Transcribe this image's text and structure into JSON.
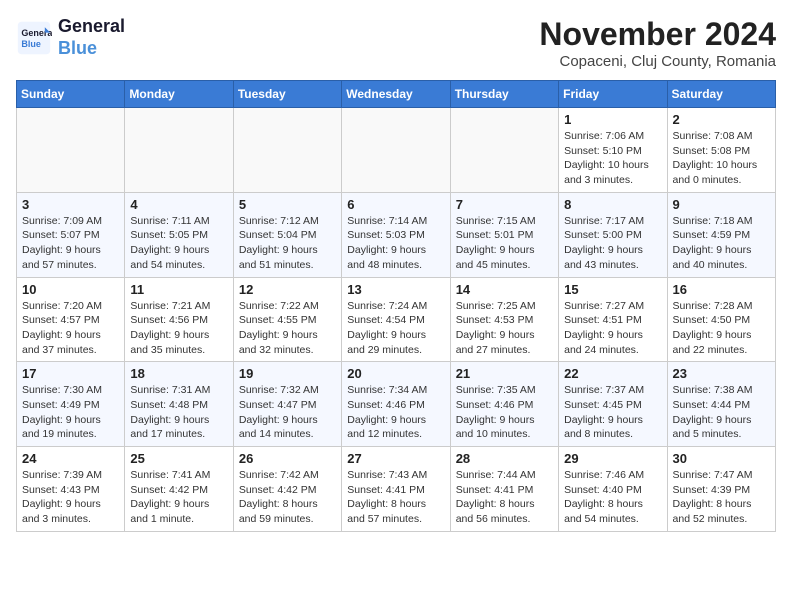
{
  "header": {
    "logo_line1": "General",
    "logo_line2": "Blue",
    "month": "November 2024",
    "location": "Copaceni, Cluj County, Romania"
  },
  "weekdays": [
    "Sunday",
    "Monday",
    "Tuesday",
    "Wednesday",
    "Thursday",
    "Friday",
    "Saturday"
  ],
  "weeks": [
    [
      {
        "day": "",
        "info": ""
      },
      {
        "day": "",
        "info": ""
      },
      {
        "day": "",
        "info": ""
      },
      {
        "day": "",
        "info": ""
      },
      {
        "day": "",
        "info": ""
      },
      {
        "day": "1",
        "info": "Sunrise: 7:06 AM\nSunset: 5:10 PM\nDaylight: 10 hours and 3 minutes."
      },
      {
        "day": "2",
        "info": "Sunrise: 7:08 AM\nSunset: 5:08 PM\nDaylight: 10 hours and 0 minutes."
      }
    ],
    [
      {
        "day": "3",
        "info": "Sunrise: 7:09 AM\nSunset: 5:07 PM\nDaylight: 9 hours and 57 minutes."
      },
      {
        "day": "4",
        "info": "Sunrise: 7:11 AM\nSunset: 5:05 PM\nDaylight: 9 hours and 54 minutes."
      },
      {
        "day": "5",
        "info": "Sunrise: 7:12 AM\nSunset: 5:04 PM\nDaylight: 9 hours and 51 minutes."
      },
      {
        "day": "6",
        "info": "Sunrise: 7:14 AM\nSunset: 5:03 PM\nDaylight: 9 hours and 48 minutes."
      },
      {
        "day": "7",
        "info": "Sunrise: 7:15 AM\nSunset: 5:01 PM\nDaylight: 9 hours and 45 minutes."
      },
      {
        "day": "8",
        "info": "Sunrise: 7:17 AM\nSunset: 5:00 PM\nDaylight: 9 hours and 43 minutes."
      },
      {
        "day": "9",
        "info": "Sunrise: 7:18 AM\nSunset: 4:59 PM\nDaylight: 9 hours and 40 minutes."
      }
    ],
    [
      {
        "day": "10",
        "info": "Sunrise: 7:20 AM\nSunset: 4:57 PM\nDaylight: 9 hours and 37 minutes."
      },
      {
        "day": "11",
        "info": "Sunrise: 7:21 AM\nSunset: 4:56 PM\nDaylight: 9 hours and 35 minutes."
      },
      {
        "day": "12",
        "info": "Sunrise: 7:22 AM\nSunset: 4:55 PM\nDaylight: 9 hours and 32 minutes."
      },
      {
        "day": "13",
        "info": "Sunrise: 7:24 AM\nSunset: 4:54 PM\nDaylight: 9 hours and 29 minutes."
      },
      {
        "day": "14",
        "info": "Sunrise: 7:25 AM\nSunset: 4:53 PM\nDaylight: 9 hours and 27 minutes."
      },
      {
        "day": "15",
        "info": "Sunrise: 7:27 AM\nSunset: 4:51 PM\nDaylight: 9 hours and 24 minutes."
      },
      {
        "day": "16",
        "info": "Sunrise: 7:28 AM\nSunset: 4:50 PM\nDaylight: 9 hours and 22 minutes."
      }
    ],
    [
      {
        "day": "17",
        "info": "Sunrise: 7:30 AM\nSunset: 4:49 PM\nDaylight: 9 hours and 19 minutes."
      },
      {
        "day": "18",
        "info": "Sunrise: 7:31 AM\nSunset: 4:48 PM\nDaylight: 9 hours and 17 minutes."
      },
      {
        "day": "19",
        "info": "Sunrise: 7:32 AM\nSunset: 4:47 PM\nDaylight: 9 hours and 14 minutes."
      },
      {
        "day": "20",
        "info": "Sunrise: 7:34 AM\nSunset: 4:46 PM\nDaylight: 9 hours and 12 minutes."
      },
      {
        "day": "21",
        "info": "Sunrise: 7:35 AM\nSunset: 4:46 PM\nDaylight: 9 hours and 10 minutes."
      },
      {
        "day": "22",
        "info": "Sunrise: 7:37 AM\nSunset: 4:45 PM\nDaylight: 9 hours and 8 minutes."
      },
      {
        "day": "23",
        "info": "Sunrise: 7:38 AM\nSunset: 4:44 PM\nDaylight: 9 hours and 5 minutes."
      }
    ],
    [
      {
        "day": "24",
        "info": "Sunrise: 7:39 AM\nSunset: 4:43 PM\nDaylight: 9 hours and 3 minutes."
      },
      {
        "day": "25",
        "info": "Sunrise: 7:41 AM\nSunset: 4:42 PM\nDaylight: 9 hours and 1 minute."
      },
      {
        "day": "26",
        "info": "Sunrise: 7:42 AM\nSunset: 4:42 PM\nDaylight: 8 hours and 59 minutes."
      },
      {
        "day": "27",
        "info": "Sunrise: 7:43 AM\nSunset: 4:41 PM\nDaylight: 8 hours and 57 minutes."
      },
      {
        "day": "28",
        "info": "Sunrise: 7:44 AM\nSunset: 4:41 PM\nDaylight: 8 hours and 56 minutes."
      },
      {
        "day": "29",
        "info": "Sunrise: 7:46 AM\nSunset: 4:40 PM\nDaylight: 8 hours and 54 minutes."
      },
      {
        "day": "30",
        "info": "Sunrise: 7:47 AM\nSunset: 4:39 PM\nDaylight: 8 hours and 52 minutes."
      }
    ]
  ]
}
